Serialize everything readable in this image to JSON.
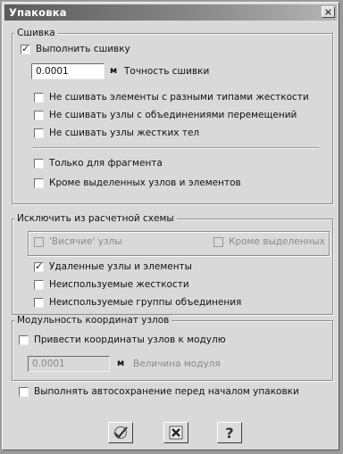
{
  "window": {
    "title": "Упаковка",
    "close_glyph": "×"
  },
  "stitching": {
    "legend": "Сшивка",
    "perform": {
      "label": "Выполнить сшивку",
      "checked": true
    },
    "tolerance": {
      "value": "0.0001",
      "unit": "м",
      "label": "Точность сшивки"
    },
    "options": [
      {
        "label": "Не сшивать элементы с разными типами жесткости",
        "checked": false
      },
      {
        "label": "Не сшивать узлы с объединениями перемещений",
        "checked": false
      },
      {
        "label": "Не сшивать узлы жестких тел",
        "checked": false
      }
    ],
    "fragment_only": {
      "label": "Только для фрагмента",
      "checked": false
    },
    "except_selected": {
      "label": "Кроме выделенных узлов и элементов",
      "checked": false
    }
  },
  "exclude": {
    "legend": "Исключить из расчетной схемы",
    "hanging_nodes": {
      "label": "'Висячие' узлы",
      "checked": false,
      "disabled": true
    },
    "except_selected": {
      "label": "Кроме выделенных",
      "checked": false,
      "disabled": true
    },
    "deleted": {
      "label": "Удаленные узлы и элементы",
      "checked": true
    },
    "unused_stiffness": {
      "label": "Неиспользуемые жесткости",
      "checked": false
    },
    "unused_groups": {
      "label": "Неиспользуемые группы объединения",
      "checked": false
    }
  },
  "modulus": {
    "legend": "Модульность координат узлов",
    "bring": {
      "label": "Привести координаты узлов к модулю",
      "checked": false
    },
    "value": "0.0001",
    "unit": "м",
    "value_label": "Величина модуля"
  },
  "autosave": {
    "label": "Выполнять автосохранение перед началом упаковки",
    "checked": false
  },
  "buttons": {
    "ok_icon": "check-icon",
    "cancel_icon": "cross-icon",
    "help_icon": "question-icon",
    "help_glyph": "?"
  }
}
